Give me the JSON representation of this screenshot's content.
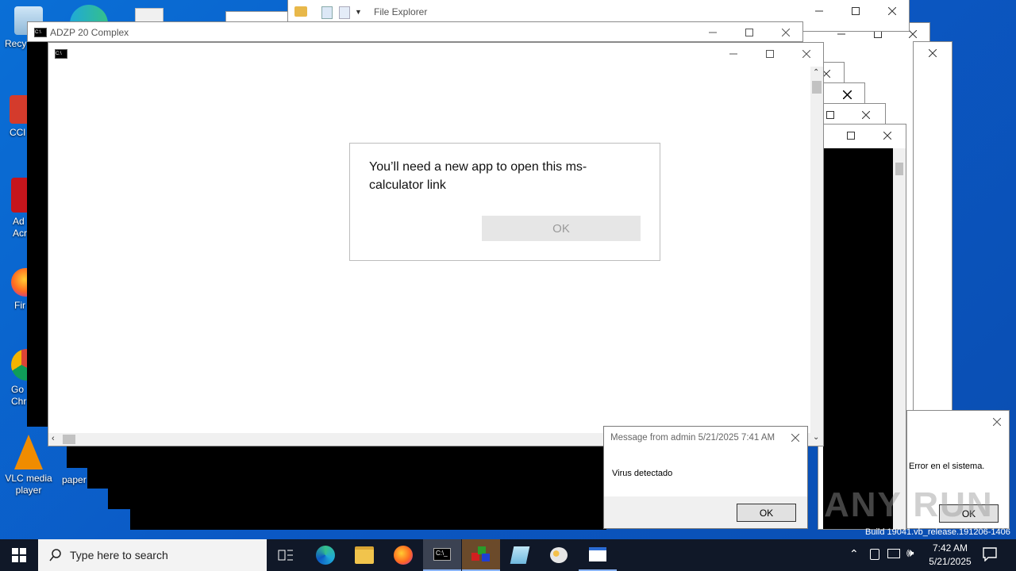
{
  "desktop": {
    "icons": [
      {
        "label": "Recy"
      },
      {
        "label": "CCl"
      },
      {
        "label": "Ad Acr"
      },
      {
        "label": "Fir"
      },
      {
        "label": "Go Chr"
      },
      {
        "label": "VLC media player"
      },
      {
        "label": "paper"
      }
    ],
    "watermark": "ANY RUN",
    "build_text": "Build 19041.vb_release.191206-1406"
  },
  "file_explorer": {
    "title": "File Explorer"
  },
  "cmd_window": {
    "title": "ADZP 20 Complex"
  },
  "app_dialog": {
    "message": "You’ll need a new app to open this ms-calculator link",
    "ok_label": "OK"
  },
  "msg_dialog": {
    "title": "Message from admin 5/21/2025 7:41 AM",
    "body": "Virus detectado",
    "ok_label": "OK"
  },
  "error_dialog": {
    "body": "Error en el sistema.",
    "ok_label": "OK"
  },
  "taskbar": {
    "search_placeholder": "Type here to search",
    "time": "7:42 AM",
    "date": "5/21/2025"
  }
}
